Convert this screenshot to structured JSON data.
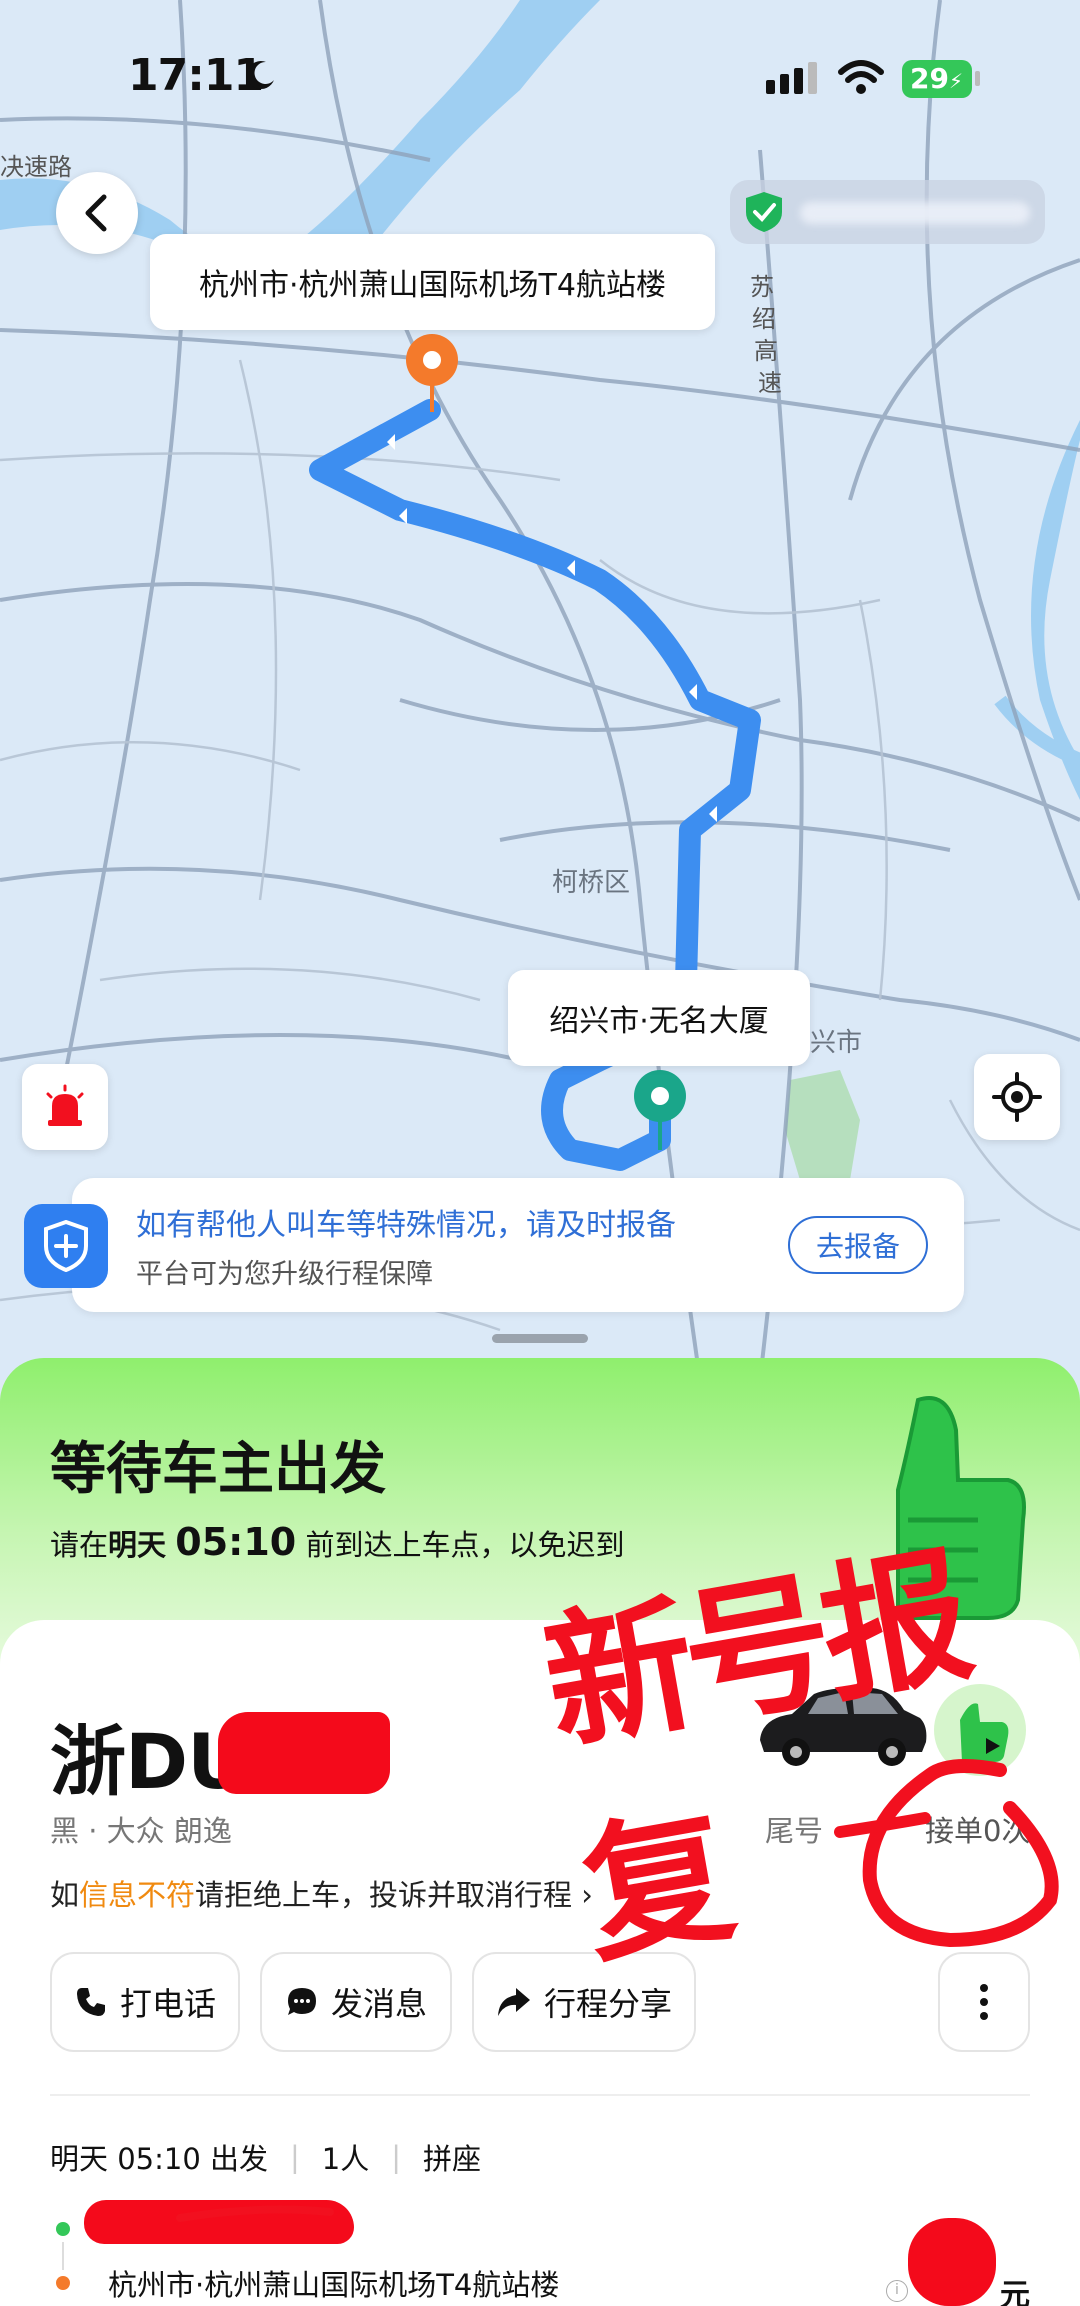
{
  "status_bar": {
    "time": "17:11",
    "battery": "29"
  },
  "map": {
    "destination_label": "杭州市·杭州萧山国际机场T4航站楼",
    "origin_label": "绍兴市·无名大厦",
    "district": "柯桥区",
    "district_partial": "兴市",
    "road_vertical": [
      "苏",
      "绍",
      "高",
      "速"
    ],
    "road_top": "决速路",
    "route_color": "#3d8ef0"
  },
  "notice": {
    "title": "如有帮他人叫车等特殊情况，请及时报备",
    "subtitle": "平台可为您升级行程保障",
    "button": "去报备"
  },
  "status": {
    "title": "等待车主出发",
    "sub_prefix": "请在",
    "sub_day": "明天",
    "sub_time": "05:10",
    "sub_suffix": "前到达上车点，以免迟到"
  },
  "driver": {
    "plate": "浙DU",
    "car_desc": "黑 · 大众 朗逸",
    "tail_label": "尾号",
    "orders": "接单0次",
    "warn_prefix": "如",
    "warn_highlight": "信息不符",
    "warn_suffix": "请拒绝上车，投诉并取消行程 ›"
  },
  "actions": {
    "call": "打电话",
    "message": "发消息",
    "share": "行程分享"
  },
  "trip": {
    "depart": "明天 05:10 出发",
    "people": "1人",
    "type": "拼座",
    "destination": "杭州市·杭州萧山国际机场T4航站楼",
    "price_unit": "元"
  },
  "annotation": {
    "handwriting": "新号报复"
  },
  "colors": {
    "accent_blue": "#2f6fd6",
    "status_green": "#8fef6d",
    "annotation_red": "#f2101f",
    "highlight_orange": "#f08a10"
  }
}
